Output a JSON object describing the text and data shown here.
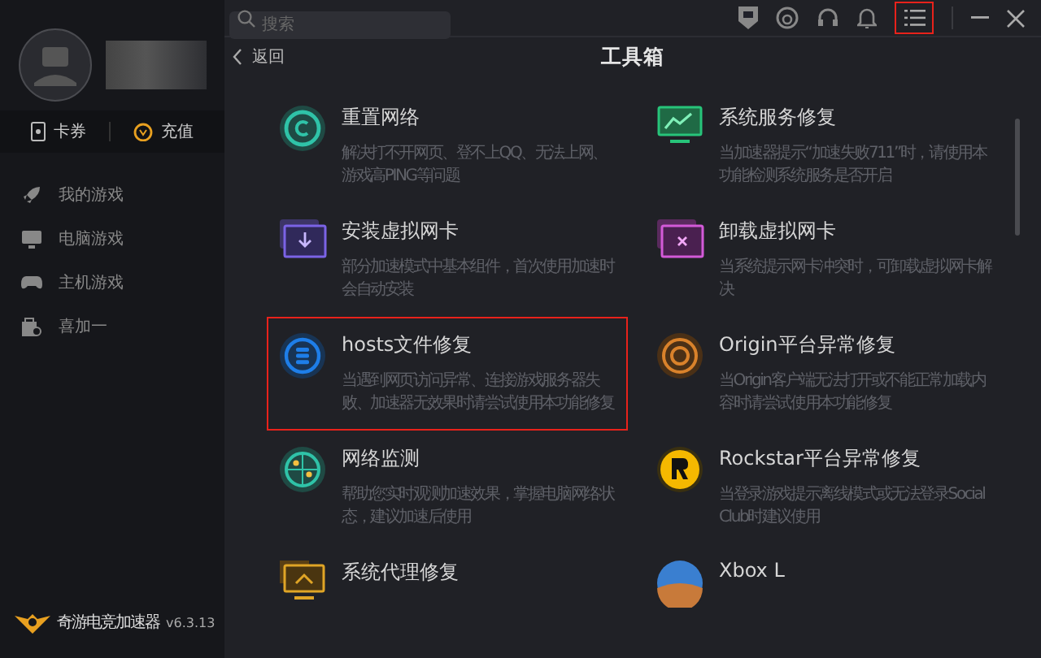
{
  "sidebar": {
    "wallet_tabs": [
      {
        "kind": "coupon",
        "label": "卡券"
      },
      {
        "kind": "recharge",
        "label": "充值"
      }
    ],
    "nav_items": [
      {
        "kind": "rocket",
        "label": "我的游戏"
      },
      {
        "kind": "pc",
        "label": "电脑游戏"
      },
      {
        "kind": "gamepad",
        "label": "主机游戏"
      },
      {
        "kind": "bag",
        "label": "喜加一"
      }
    ],
    "brand": {
      "name": "奇游电竞加速器",
      "version": "v6.3.13"
    }
  },
  "top_bar": {
    "search": {
      "placeholder": "搜索"
    },
    "menu_highlighted": true
  },
  "toolbox": {
    "back": "返回",
    "title": "工具箱",
    "tools": [
      {
        "kind": "reset",
        "title": "重置网络",
        "description": "解决打不开网页、登不上QQ、无法上网、游戏高PING等问题",
        "highlighted": false
      },
      {
        "kind": "service",
        "title": "系统服务修复",
        "description": "当加速器提示“加速失败711”时，请使用本功能检测系统服务是否开启",
        "highlighted": false
      },
      {
        "kind": "install",
        "title": "安装虚拟网卡",
        "description": "部分加速模式中基本组件，首次使用加速时会自动安装",
        "highlighted": false
      },
      {
        "kind": "uninstall",
        "title": "卸载虚拟网卡",
        "description": "当系统提示网卡冲突时，可卸载虚拟网卡解决",
        "highlighted": false
      },
      {
        "kind": "hosts",
        "title": "hosts文件修复",
        "description": "当遇到网页访问异常、连接游戏服务器失败、加速器无效果时请尝试使用本功能修复",
        "highlighted": true
      },
      {
        "kind": "origin",
        "title": "Origin平台异常修复",
        "description": "当Origin客户端无法打开或不能正常加载内容时请尝试使用本功能修复",
        "highlighted": false
      },
      {
        "kind": "monitor",
        "title": "网络监测",
        "description": "帮助您实时观测加速效果，掌握电脑网络状态，建议加速后使用",
        "highlighted": false
      },
      {
        "kind": "rockstar",
        "title": "Rockstar平台异常修复",
        "description": "当登录游戏提示离线模式或无法登录Social Club时建议使用",
        "highlighted": false
      },
      {
        "kind": "proxy",
        "title": "系统代理修复",
        "highlighted": false
      },
      {
        "kind": "game",
        "title": "Xbox L",
        "highlighted": false
      }
    ]
  }
}
